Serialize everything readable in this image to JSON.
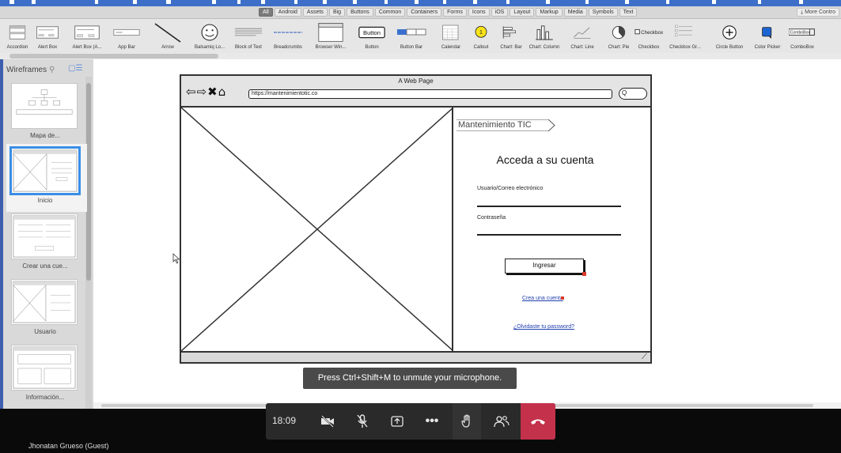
{
  "filter_bar": {
    "tags": [
      "All",
      "Android",
      "Assets",
      "Big",
      "Buttons",
      "Common",
      "Containers",
      "Forms",
      "Icons",
      "iOS",
      "Layout",
      "Markup",
      "Media",
      "Symbols",
      "Text"
    ],
    "active_tag": "All",
    "more_controls": "More Contro"
  },
  "library": {
    "items": [
      {
        "label": "Accordion",
        "icon": "accordion-icon"
      },
      {
        "label": "Alert Box",
        "icon": "alert-box-icon"
      },
      {
        "label": "Alert Box (A...",
        "icon": "alert-box-alt-icon"
      },
      {
        "label": "App Bar",
        "icon": "app-bar-icon"
      },
      {
        "label": "Arrow",
        "icon": "arrow-icon"
      },
      {
        "label": "Balsamiq Lo...",
        "icon": "balsamiq-logo-icon"
      },
      {
        "label": "Block of Text",
        "icon": "block-of-text-icon"
      },
      {
        "label": "Breadcrumbs",
        "icon": "breadcrumbs-icon"
      },
      {
        "label": "Browser Win...",
        "icon": "browser-window-icon"
      },
      {
        "label": "Button",
        "icon": "button-icon",
        "thumb_text": "Button"
      },
      {
        "label": "Button Bar",
        "icon": "button-bar-icon"
      },
      {
        "label": "Calendar",
        "icon": "calendar-icon"
      },
      {
        "label": "Callout",
        "icon": "callout-icon",
        "thumb_text": "1"
      },
      {
        "label": "Chart: Bar",
        "icon": "chart-bar-icon"
      },
      {
        "label": "Chart: Column",
        "icon": "chart-column-icon"
      },
      {
        "label": "Chart: Line",
        "icon": "chart-line-icon"
      },
      {
        "label": "Chart: Pie",
        "icon": "chart-pie-icon"
      },
      {
        "label": "Checkbox",
        "icon": "checkbox-icon",
        "thumb_text": "Checkbox"
      },
      {
        "label": "Checkbox Gr...",
        "icon": "checkbox-group-icon"
      },
      {
        "label": "Circle Button",
        "icon": "circle-button-icon"
      },
      {
        "label": "Color Picker",
        "icon": "color-picker-icon"
      },
      {
        "label": "ComboBox",
        "icon": "combobox-icon",
        "thumb_text": "ComboBox"
      }
    ]
  },
  "sidebar": {
    "title": "Wireframes",
    "pages": [
      {
        "label": "Mapa de...",
        "selected": false
      },
      {
        "label": "Inicio",
        "selected": true
      },
      {
        "label": "Crear una cue...",
        "selected": false
      },
      {
        "label": "Usuario",
        "selected": false
      },
      {
        "label": "Información...",
        "selected": false
      }
    ]
  },
  "wireframe": {
    "window_title": "A Web Page",
    "url": "https://mantenimientotic.co",
    "search_glyph": "Q",
    "breadcrumb": "Mantenimiento TIC",
    "login_title": "Acceda a su cuenta",
    "username_label": "Usuario/Correo electrónico",
    "password_label": "Contraseña",
    "login_button": "Ingresar",
    "create_account_link": "Crea una cuenta",
    "forgot_password_link": "¿Olvidaste tu password?"
  },
  "toast": {
    "message": "Press Ctrl+Shift+M to unmute your microphone."
  },
  "call": {
    "timer": "18:09",
    "participant": "Jhonatan Grueso (Guest)",
    "colors": {
      "hangup": "#c4314b",
      "bar": "#2a2a2a"
    }
  }
}
